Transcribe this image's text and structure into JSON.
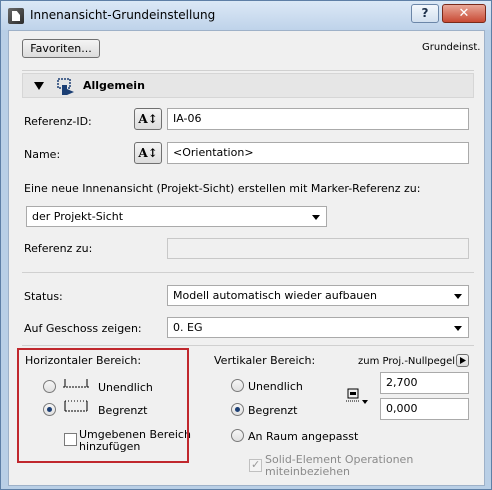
{
  "window": {
    "title": "Innenansicht-Grundeinstellung",
    "help_label": "?",
    "close_label": "✕"
  },
  "top": {
    "favorites_label": "Favoriten...",
    "preset_label": "Grundeinst."
  },
  "section": {
    "title": "Allgemein"
  },
  "reference_id": {
    "label": "Referenz-ID:",
    "value": "IA-06"
  },
  "name": {
    "label": "Name:",
    "value": "<Orientation>"
  },
  "create_view": {
    "label": "Eine neue Innenansicht (Projekt-Sicht) erstellen mit Marker-Referenz zu:",
    "selected": "der Projekt-Sicht"
  },
  "reference_to": {
    "label": "Referenz zu:",
    "value": ""
  },
  "status": {
    "label": "Status:",
    "selected": "Modell automatisch wieder aufbauen"
  },
  "show_on_story": {
    "label": "Auf Geschoss zeigen:",
    "selected": "0. EG"
  },
  "horizontal": {
    "title": "Horizontaler Bereich:",
    "option_infinite": "Unendlich",
    "option_limited": "Begrenzt",
    "selected": "Begrenzt",
    "add_surrounding_line1": "Umgebenen Bereich",
    "add_surrounding_line2": "hinzufügen",
    "add_surrounding_checked": false
  },
  "vertical": {
    "title": "Vertikaler Bereich:",
    "option_infinite": "Unendlich",
    "option_limited": "Begrenzt",
    "option_room": "An Raum angepasst",
    "selected": "Begrenzt",
    "reference_label": "zum Proj.-Nullpegel",
    "upper_value": "2,700",
    "lower_value": "0,000",
    "solid_ops_line1": "Solid-Element Operationen",
    "solid_ops_line2": "miteinbeziehen",
    "solid_ops_checked": true
  },
  "colors": {
    "highlight_frame": "#c0272d",
    "titlebar": "#bfd3ea",
    "close_button": "#c84a34"
  }
}
